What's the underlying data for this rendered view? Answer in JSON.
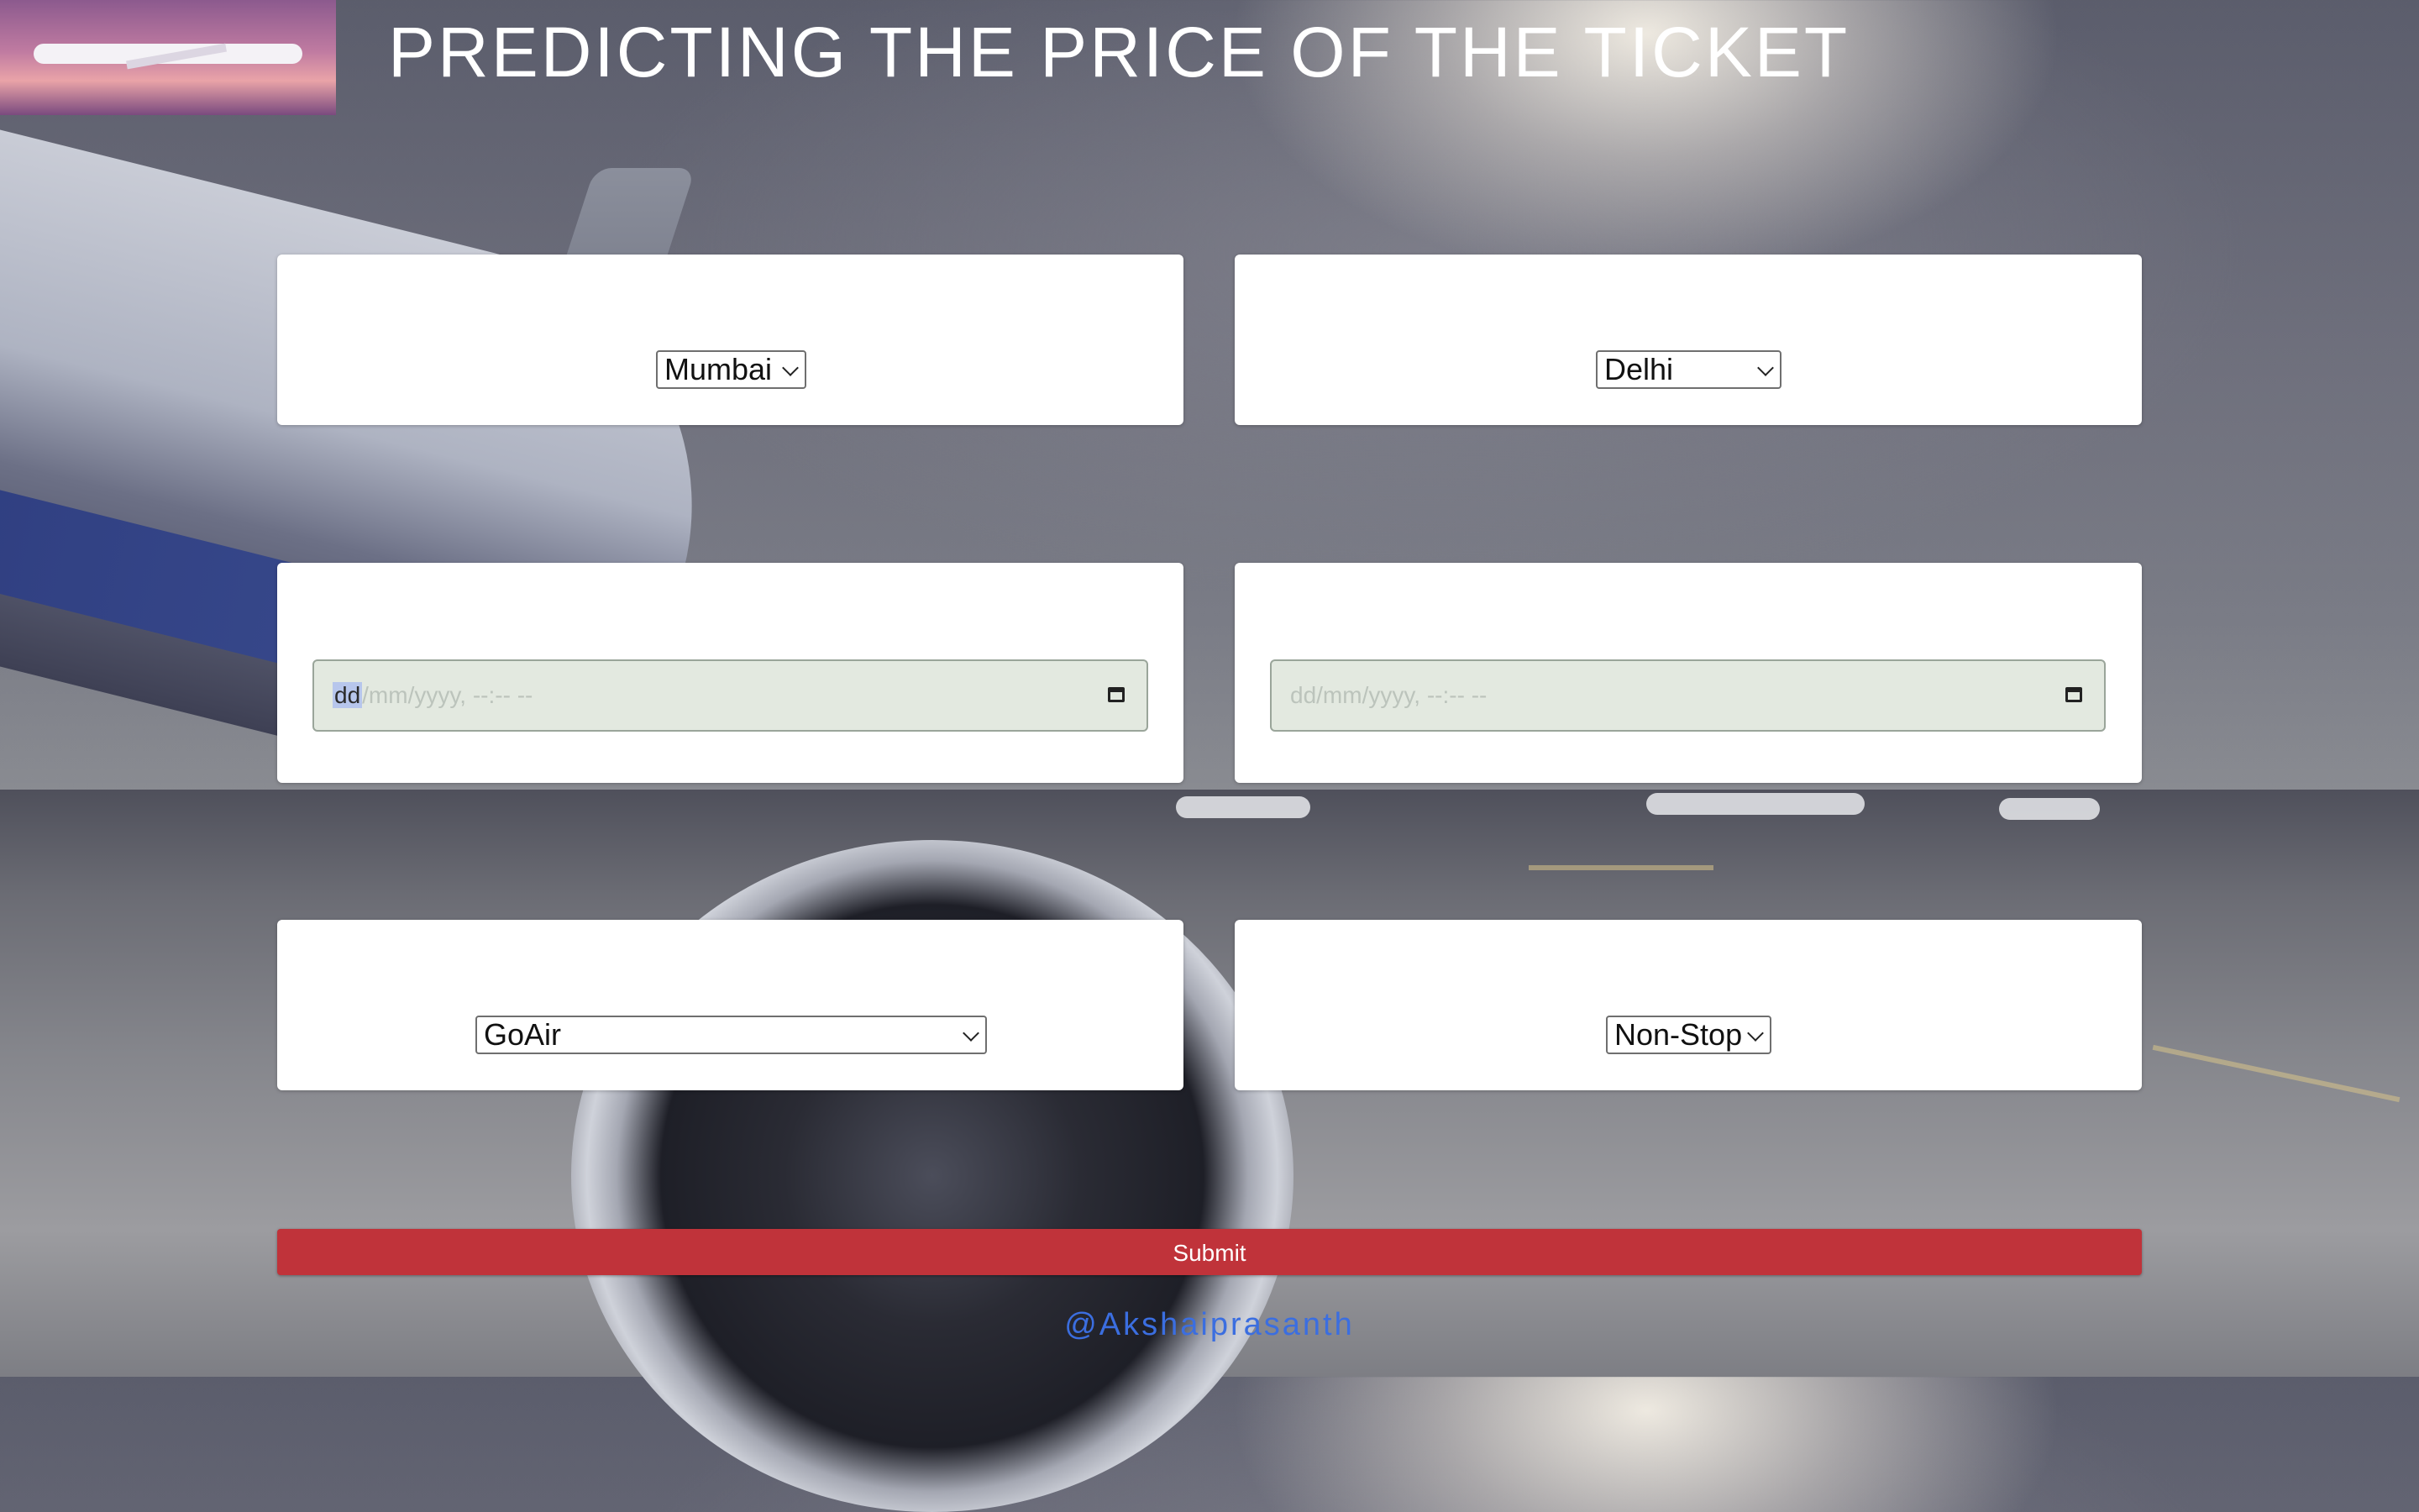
{
  "header": {
    "title": "PREDICTING THE PRICE OF THE TICKET",
    "logo_icon": "airplane-logo-image"
  },
  "form": {
    "source": {
      "selected": "Mumbai"
    },
    "destination": {
      "selected": "Delhi"
    },
    "departure": {
      "placeholder_highlight": "dd",
      "placeholder_rest": "/mm/yyyy, --:-- --"
    },
    "arrival": {
      "placeholder": "dd/mm/yyyy, --:-- --"
    },
    "airline": {
      "selected": "GoAir"
    },
    "stops": {
      "selected": "Non-Stop"
    },
    "submit_label": "Submit"
  },
  "footer": {
    "credit": "@Akshaiprasanth"
  },
  "colors": {
    "submit_bg": "#c0333a",
    "credit_text": "#3b6ee0",
    "date_input_bg": "#e3e9e0"
  }
}
